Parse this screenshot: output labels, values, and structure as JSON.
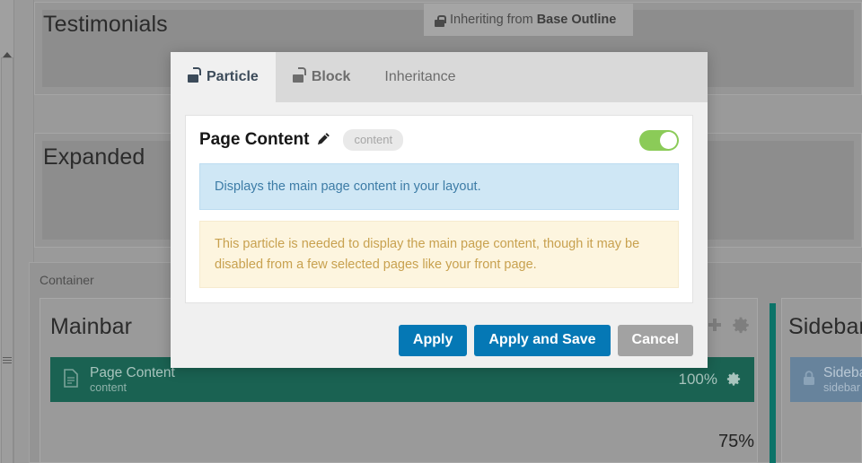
{
  "background": {
    "sections": [
      {
        "title": "Testimonials"
      },
      {
        "title": "Expanded"
      },
      {
        "title": "Container"
      },
      {
        "title": "Mainbar"
      },
      {
        "title": "Sidebar"
      }
    ],
    "inheritance_badge": {
      "lock_icon": "lock-icon",
      "prefix": "Inheriting from",
      "source": "Base Outline"
    },
    "mainbar": {
      "add_icon": "plus-icon",
      "settings_icon": "gear-icon",
      "particle": {
        "icon": "document-icon",
        "title": "Page Content",
        "subtitle": "content",
        "size": "100%",
        "settings_icon": "gear-icon"
      },
      "width_label": "75%"
    },
    "sidebar": {
      "particle": {
        "icon": "lock-icon",
        "title": "Sidebar",
        "subtitle": "sidebar"
      }
    },
    "scrollbar": {
      "up_arrow_icon": "caret-up-icon",
      "grip_icon": "grip-lines-icon"
    }
  },
  "modal": {
    "tabs": [
      {
        "label": "Particle",
        "icon": "unlock-icon",
        "active": true
      },
      {
        "label": "Block",
        "icon": "unlock-icon",
        "active": false
      },
      {
        "label": "Inheritance",
        "icon": "",
        "active": false
      }
    ],
    "card": {
      "title": "Page Content",
      "edit_icon": "pencil-icon",
      "id_pill": "content",
      "toggle": {
        "state": "on",
        "color": "#8bcb58"
      },
      "info_note": "Displays the main page content in your layout.",
      "warning_note": "This particle is needed to display the main page content, though it may be disabled from a few selected pages like your front page."
    },
    "footer": {
      "apply": "Apply",
      "apply_and_save": "Apply and Save",
      "cancel": "Cancel"
    }
  },
  "colors": {
    "primary": "#0578b5",
    "grey_button": "#a2a2a2",
    "particle_green": "#1a6252",
    "particle_blue": "#67839c",
    "divider_teal": "#0b7368",
    "toggle_green": "#8bcb58"
  }
}
